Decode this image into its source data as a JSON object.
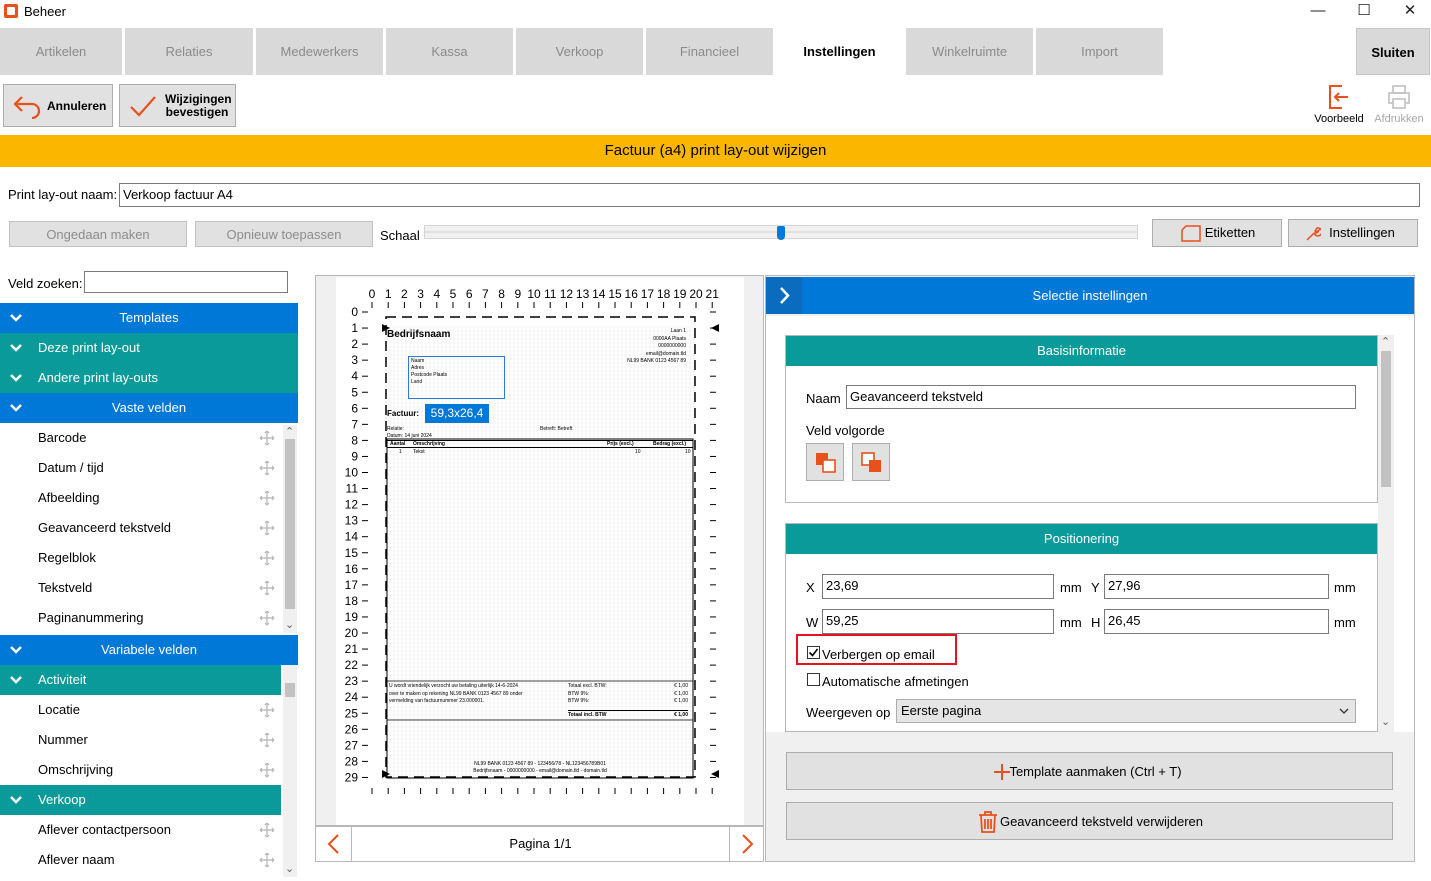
{
  "window": {
    "title": "Beheer",
    "minimize": "—",
    "maximize": "☐",
    "close": "✕"
  },
  "tabs": [
    "Artikelen",
    "Relaties",
    "Medewerkers",
    "Kassa",
    "Verkoop",
    "Financieel",
    "Instellingen",
    "Winkelruimte",
    "Import"
  ],
  "active_tab": "Instellingen",
  "close_button": "Sluiten",
  "toolbar": {
    "cancel": "Annuleren",
    "confirm_line1": "Wijzigingen",
    "confirm_line2": "bevestigen",
    "preview": "Voorbeeld",
    "print": "Afdrukken"
  },
  "banner": "Factuur (a4) print lay-out wijzigen",
  "layout_name_label": "Print lay-out naam:",
  "layout_name_value": "Verkoop factuur A4",
  "undo": "Ongedaan maken",
  "redo": "Opnieuw toepassen",
  "scale_label": "Schaal",
  "scale_value": 0.5,
  "labels_button": "Etiketten",
  "settings_button": "Instellingen",
  "search_label": "Veld zoeken:",
  "search_value": "",
  "left": {
    "templates": "Templates",
    "this_layout": "Deze print lay-out",
    "other_layouts": "Andere print lay-outs",
    "fixed_fields": "Vaste velden",
    "fixed_items": [
      "Barcode",
      "Datum / tijd",
      "Afbeelding",
      "Geavanceerd tekstveld",
      "Regelblok",
      "Tekstveld",
      "Paginanummering"
    ],
    "variable_fields": "Variabele velden",
    "activity": "Activiteit",
    "activity_items": [
      "Locatie",
      "Nummer",
      "Omschrijving"
    ],
    "sale": "Verkoop",
    "sale_items": [
      "Aflever contactpersoon",
      "Aflever naam"
    ]
  },
  "ruler_x": [
    "0",
    "1",
    "2",
    "3",
    "4",
    "5",
    "6",
    "7",
    "8",
    "9",
    "10",
    "11",
    "12",
    "13",
    "14",
    "15",
    "16",
    "17",
    "18",
    "19",
    "20",
    "21"
  ],
  "ruler_y": [
    "0",
    "1",
    "2",
    "3",
    "4",
    "5",
    "6",
    "7",
    "8",
    "9",
    "10",
    "11",
    "12",
    "13",
    "14",
    "15",
    "16",
    "17",
    "18",
    "19",
    "20",
    "21",
    "22",
    "23",
    "24",
    "25",
    "26",
    "27",
    "28",
    "29"
  ],
  "doc": {
    "company": "Bedrijfsnaam",
    "address_right": [
      "Laan 1",
      "0000AA Plaats",
      "0000000000",
      "email@domain.tld",
      "NL99 BANK 0123 4567 89"
    ],
    "recipient": [
      "Naam",
      "Adres",
      "Postcode Plaats",
      "Land"
    ],
    "invoice_label": "Factuur:",
    "size_badge": "59,3x26,4",
    "meta_left1": "Relatie:",
    "meta_left2": "Datum: 14 juni 2024",
    "meta_right": "Betreft: Betreft",
    "col_amount": "Aantal",
    "col_desc": "Omschrijving",
    "col_price": "Prijs (excl.)",
    "col_total": "Bedrag (excl.)",
    "row_qty": "1",
    "row_desc": "Tekst",
    "row_price": "10",
    "row_total": "10",
    "pay_text": [
      "U wordt vriendelijk verzocht uw betaling uiterlijk 14-6-2024",
      "over te maken op rekening NL99 BANK 0123 4567 89 onder",
      "vermelding van factuurnummer 23.000001."
    ],
    "sum_labels": [
      "Totaal excl. BTW:",
      "BTW 9%:",
      "BTW 9%:"
    ],
    "sum_values": [
      "€ 1,00",
      "€ 1,00",
      "€ 1,00"
    ],
    "total_label": "Totaal incl. BTW",
    "total_value": "€ 1,00",
    "footer1": "NL99 BANK 0123 4567 89 - 123456/78 - NL123456789B01",
    "footer2": "Bedrijfsnaam - 0000000000 - email@domain.tld - domain.tld"
  },
  "page_label": "Pagina 1/1",
  "selection": {
    "header": "Selectie instellingen",
    "basis_header": "Basisinformatie",
    "name_label": "Naam",
    "name_value": "Geavanceerd tekstveld",
    "order_label": "Veld volgorde",
    "pos_header": "Positionering",
    "x_label": "X",
    "x_value": "23,69",
    "y_label": "Y",
    "y_value": "27,96",
    "w_label": "W",
    "w_value": "59,25",
    "h_label": "H",
    "h_value": "26,45",
    "unit": "mm",
    "hide_email": "Verbergen op email",
    "hide_email_checked": true,
    "auto_size": "Automatische afmetingen",
    "auto_size_checked": false,
    "show_on_label": "Weergeven op",
    "show_on_value": "Eerste pagina",
    "template_btn": "Template aanmaken (Ctrl + T)",
    "delete_btn": "Geavanceerd tekstveld verwijderen"
  },
  "colors": {
    "accent": "#fbb700",
    "blue": "#0078d7",
    "teal": "#0a9a9a",
    "orange_icon": "#e8511b",
    "highlight": "#e81123"
  }
}
